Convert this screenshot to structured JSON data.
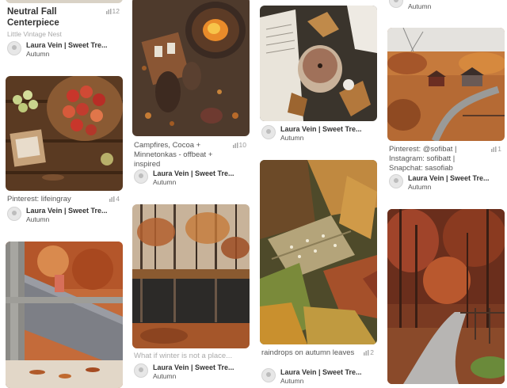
{
  "pins": {
    "p1": {
      "title": "Neutral Fall Centerpiece",
      "source": "Little Vintage Nest",
      "saves": "12",
      "user": "Laura Vein | Sweet Tre...",
      "board": "Autumn"
    },
    "p2": {
      "caption": "Pinterest: lifeingray",
      "saves": "4",
      "user": "Laura Vein | Sweet Tre...",
      "board": "Autumn"
    },
    "p4": {
      "caption": "Campfires, Cocoa + Minnetonkas - offbeat + inspired",
      "saves": "10",
      "user": "Laura Vein | Sweet Tre...",
      "board": "Autumn"
    },
    "p5": {
      "caption": "What if winter is not a place...",
      "user": "Laura Vein | Sweet Tre...",
      "board": "Autumn"
    },
    "p6": {
      "user": "Laura Vein | Sweet Tre...",
      "board": "Autumn"
    },
    "p7": {
      "caption": "raindrops on autumn leaves",
      "saves": "2",
      "user": "Laura Vein | Sweet Tre...",
      "board": "Autumn"
    },
    "p8": {
      "board": "Autumn"
    },
    "p9": {
      "caption": "Pinterest: @sofibat | Instagram: sofibatt | Snapchat: sasofiab",
      "saves": "1",
      "user": "Laura Vein | Sweet Tre...",
      "board": "Autumn"
    }
  },
  "icons": {
    "save_count": "pin-icon",
    "avatar": "user-avatar-icon"
  },
  "colors": {
    "accent_text": "#333333",
    "muted_text": "#999999",
    "autumn_orange": "#b8561f"
  }
}
